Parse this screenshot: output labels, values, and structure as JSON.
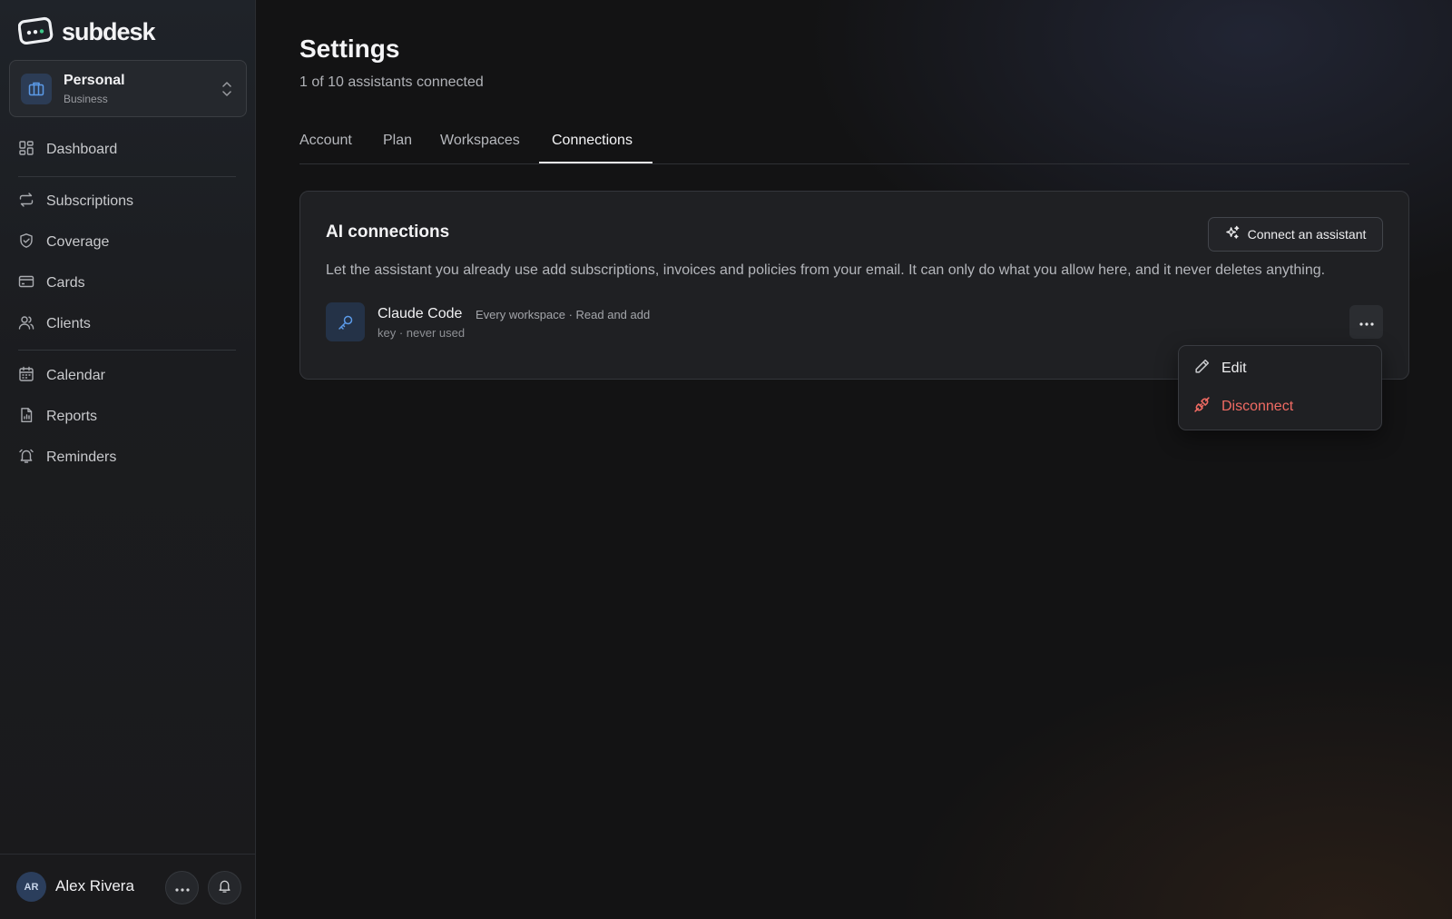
{
  "app": {
    "brand": "subdesk"
  },
  "workspace": {
    "name": "Personal",
    "type": "Business"
  },
  "sidebar": {
    "items": [
      {
        "label": "Dashboard",
        "icon": "dashboard-icon"
      },
      {
        "label": "Subscriptions",
        "icon": "repeat-icon"
      },
      {
        "label": "Coverage",
        "icon": "shield-check-icon"
      },
      {
        "label": "Cards",
        "icon": "credit-card-icon"
      },
      {
        "label": "Clients",
        "icon": "users-icon"
      },
      {
        "label": "Calendar",
        "icon": "calendar-icon"
      },
      {
        "label": "Reports",
        "icon": "report-icon"
      },
      {
        "label": "Reminders",
        "icon": "bell-icon"
      }
    ]
  },
  "user": {
    "initials": "AR",
    "name": "Alex Rivera"
  },
  "header": {
    "title": "Settings",
    "subtitle": "1 of 10 assistants connected"
  },
  "tabs": [
    {
      "label": "Account"
    },
    {
      "label": "Plan"
    },
    {
      "label": "Workspaces"
    },
    {
      "label": "Connections",
      "active": true
    }
  ],
  "ai_connections": {
    "title": "AI connections",
    "connect_button": "Connect an assistant",
    "description": "Let the assistant you already use add subscriptions, invoices and policies from your email. It can only do what you allow here, and it never deletes anything.",
    "items": [
      {
        "name": "Claude Code",
        "meta": "Every workspace · Read and add",
        "sub": "key · never used"
      }
    ]
  },
  "menu": {
    "edit": "Edit",
    "disconnect": "Disconnect"
  },
  "colors": {
    "accent": "#4f8fe0",
    "danger": "#f06b63",
    "background": "#131314"
  }
}
